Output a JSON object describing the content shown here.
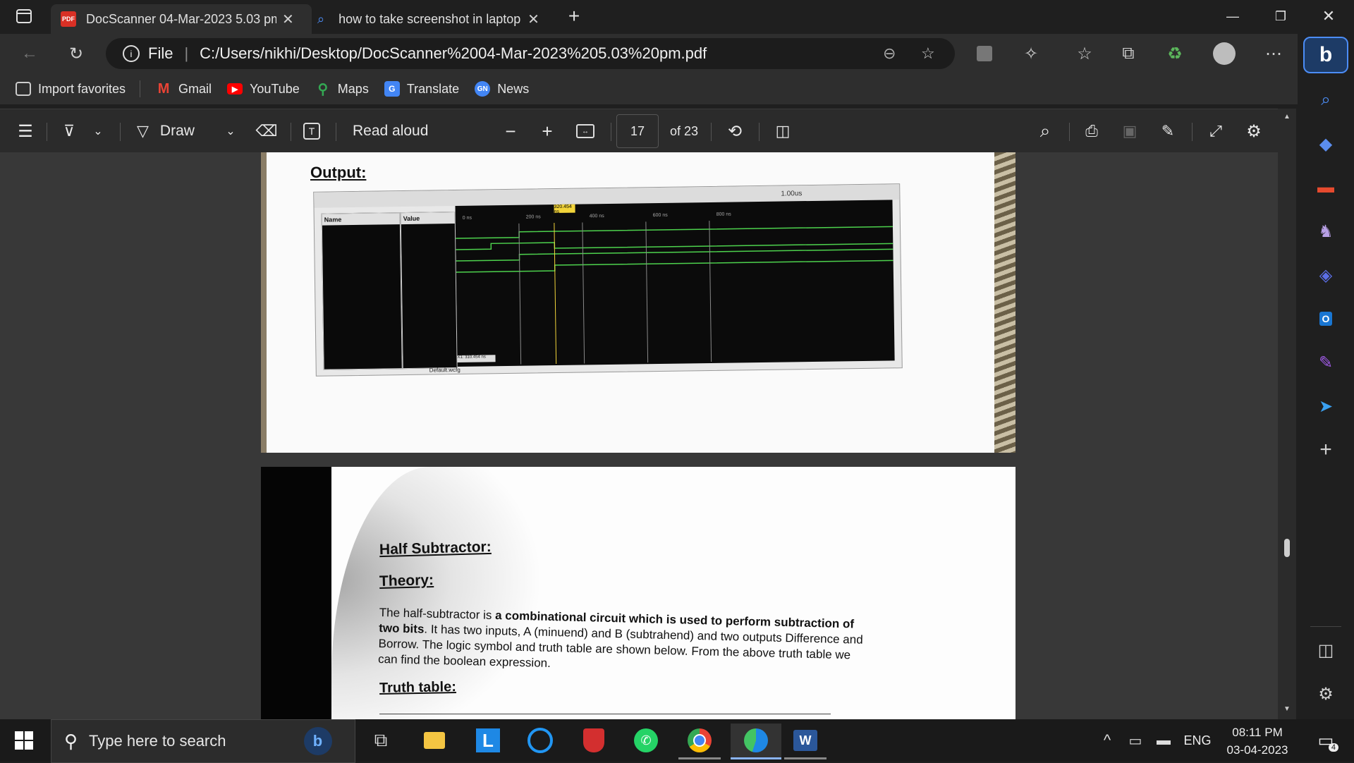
{
  "tabs": [
    {
      "title": "DocScanner 04-Mar-2023 5.03 pm",
      "icon": "pdf-icon",
      "active": true
    },
    {
      "title": "how to take screenshot in laptop",
      "icon": "search-icon",
      "active": false
    }
  ],
  "address": {
    "scheme": "File",
    "url": "C:/Users/nikhi/Desktop/DocScanner%2004-Mar-2023%205.03%20pm.pdf"
  },
  "favorites": [
    {
      "label": "Import favorites",
      "icon": "import-icon",
      "color": "#e6e6e6"
    },
    {
      "label": "Gmail",
      "icon": "gmail-icon",
      "color": "#ea4335"
    },
    {
      "label": "YouTube",
      "icon": "youtube-icon",
      "color": "#ff0000"
    },
    {
      "label": "Maps",
      "icon": "maps-icon",
      "color": "#34a853"
    },
    {
      "label": "Translate",
      "icon": "translate-icon",
      "color": "#4285f4"
    },
    {
      "label": "News",
      "icon": "news-icon",
      "color": "#4285f4"
    }
  ],
  "pdf_toolbar": {
    "draw_label": "Draw",
    "read_aloud_label": "Read aloud",
    "page_current": "17",
    "page_total": "of 23"
  },
  "page1": {
    "heading": "Output:",
    "name_col": "Name",
    "value_col": "Value",
    "cursor_time": "320.454 ns",
    "ticks": [
      "0 ns",
      "200 ns",
      "400 ns",
      "600 ns",
      "800 ns"
    ],
    "marker_label": "X1: 310.454 ns",
    "tab_label": "Default.wcfg",
    "zoom_label": "1.00us"
  },
  "page2": {
    "title": "Half Subtractor:",
    "subtitle": "Theory:",
    "line1_a": "The half-subtractor is ",
    "line1_b": "a combinational circuit which is used to perform subtraction of",
    "line2_a": "two bits",
    "line2_b": ". It has two inputs, A (minuend) and B (subtrahend) and two outputs Difference and",
    "line3": "Borrow. The logic symbol and truth table are shown below. From the above truth table we",
    "line4": "can find the boolean expression.",
    "truth_heading": "Truth table:"
  },
  "taskbar": {
    "search_placeholder": "Type here to search",
    "language": "ENG",
    "time": "08:11 PM",
    "date": "03-04-2023",
    "notifications": "4"
  }
}
